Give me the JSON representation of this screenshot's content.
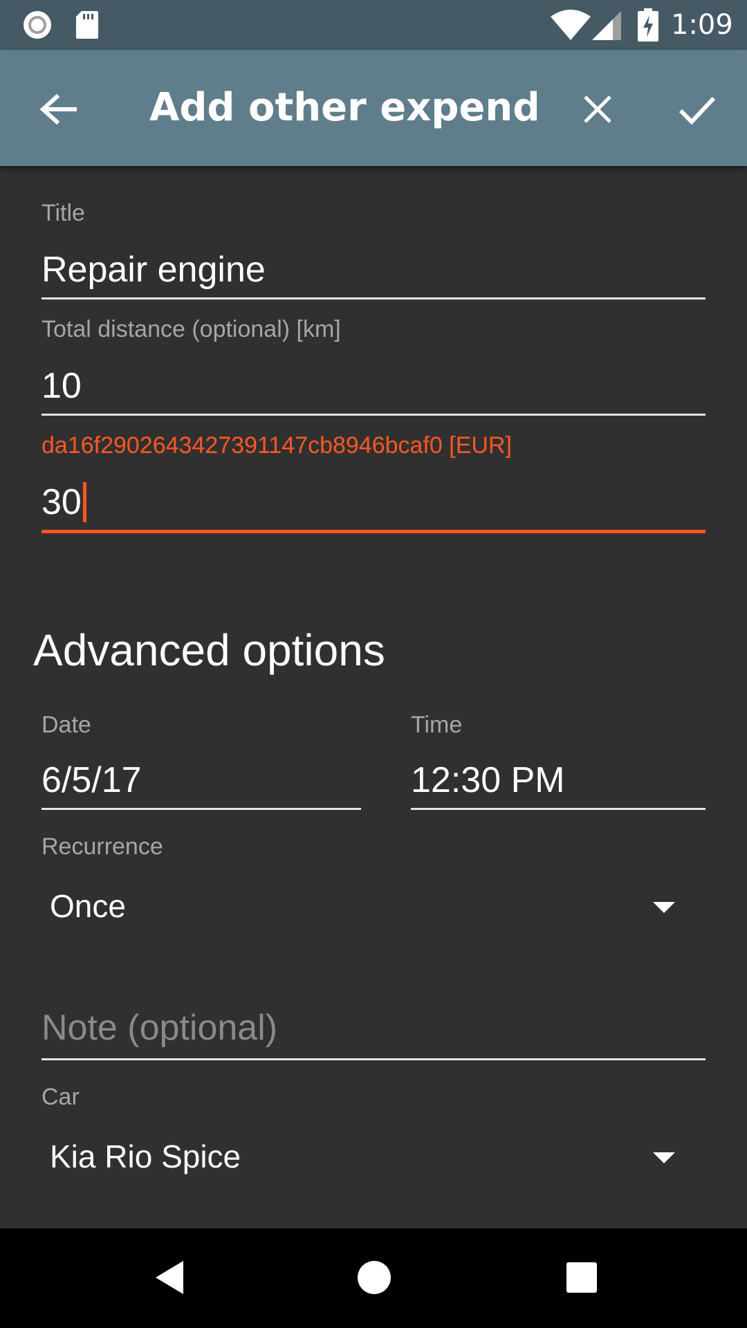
{
  "status_bar": {
    "time": "1:09",
    "icons": [
      "record-icon",
      "sd-card-icon",
      "wifi-icon",
      "cell-signal-icon",
      "battery-charging-icon"
    ]
  },
  "app_bar": {
    "title": "Add other expendit…",
    "back_icon": "arrow-left-icon",
    "close_icon": "close-icon",
    "confirm_icon": "check-icon"
  },
  "form": {
    "title": {
      "label": "Title",
      "value": "Repair engine"
    },
    "distance": {
      "label": "Total distance (optional) [km]",
      "value": "10"
    },
    "price": {
      "label": "da16f2902643427391147cb8946bcaf0 [EUR]",
      "value": "30",
      "accent_color": "#ff5722"
    }
  },
  "advanced": {
    "heading": "Advanced options",
    "date": {
      "label": "Date",
      "value": "6/5/17"
    },
    "time": {
      "label": "Time",
      "value": "12:30 PM"
    },
    "recurrence": {
      "label": "Recurrence",
      "value": "Once"
    },
    "note": {
      "placeholder": "Note (optional)"
    },
    "car": {
      "label": "Car",
      "value": "Kia Rio Spice"
    }
  },
  "colors": {
    "status_bar": "#455a64",
    "app_bar": "#607d8b",
    "background": "#303030",
    "error_accent": "#ff5722"
  },
  "nav_bar": {
    "icons": [
      "nav-back-icon",
      "nav-home-icon",
      "nav-recents-icon"
    ]
  }
}
